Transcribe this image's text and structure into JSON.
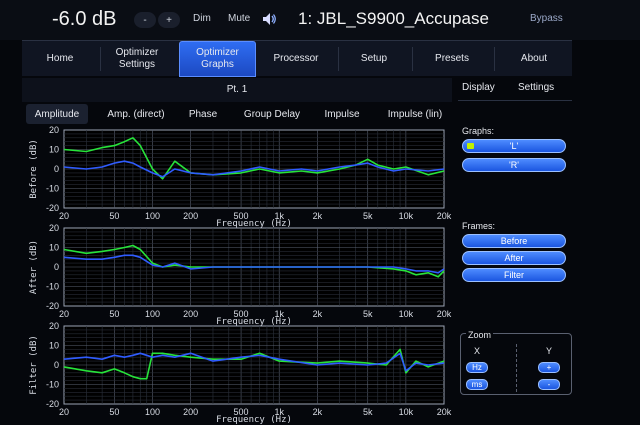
{
  "header": {
    "gain": "-6.0 dB",
    "minus_label": "-",
    "plus_label": "+",
    "dim_label": "Dim",
    "mute_label": "Mute",
    "device_name": "1: JBL_S9900_Accupase",
    "bypass_label": "Bypass"
  },
  "tabs": [
    {
      "label": "Home"
    },
    {
      "label": "Optimizer Settings"
    },
    {
      "label": "Optimizer Graphs"
    },
    {
      "label": "Processor"
    },
    {
      "label": "Setup"
    },
    {
      "label": "Presets"
    },
    {
      "label": "About"
    }
  ],
  "subbar": {
    "title": "Pt. 1",
    "display_tab": "Display",
    "settings_tab": "Settings"
  },
  "view_tabs": [
    {
      "label": "Amplitude"
    },
    {
      "label": "Amp. (direct)"
    },
    {
      "label": "Phase"
    },
    {
      "label": "Group Delay"
    },
    {
      "label": "Impulse"
    },
    {
      "label": "Impulse (lin)"
    }
  ],
  "side": {
    "graphs_label": "Graphs:",
    "graph_buttons": [
      "'L'",
      "'R'"
    ],
    "frames_label": "Frames:",
    "frame_buttons": [
      "Before",
      "After",
      "Filter"
    ],
    "zoom_label": "Zoom",
    "zoom_x": "X",
    "zoom_y": "Y",
    "zoom_hz": "Hz",
    "zoom_ms": "ms",
    "zoom_plus": "+",
    "zoom_minus": "-"
  },
  "colors": {
    "left_trace": "#27e33a",
    "right_trace": "#2f5cff",
    "accent": "#2f6df2",
    "led": "#bff000"
  },
  "chart_data": [
    {
      "type": "line",
      "ylabel": "Before (dB)",
      "xlabel": "Frequency (Hz)",
      "x_scale": "log",
      "xlim": [
        20,
        20000
      ],
      "ylim": [
        -20,
        20
      ],
      "yticks": [
        20,
        10,
        0,
        -10,
        -20
      ],
      "xticks": [
        "20",
        "50",
        "100",
        "200",
        "500",
        "1k",
        "2k",
        "5k",
        "10k",
        "20k"
      ],
      "series": [
        {
          "name": "'L'",
          "x": [
            20,
            30,
            40,
            50,
            60,
            70,
            80,
            100,
            120,
            150,
            200,
            300,
            500,
            700,
            1000,
            1500,
            2000,
            3000,
            4000,
            5000,
            6000,
            8000,
            10000,
            15000,
            20000
          ],
          "y": [
            10,
            9,
            11,
            12,
            14,
            16,
            12,
            0,
            -5,
            4,
            -2,
            -3,
            -2,
            0,
            -2,
            -1,
            -2,
            0,
            2,
            5,
            2,
            0,
            1,
            -3,
            -1
          ]
        },
        {
          "name": "'R'",
          "x": [
            20,
            30,
            40,
            50,
            60,
            70,
            80,
            100,
            120,
            150,
            200,
            300,
            500,
            700,
            1000,
            1500,
            2000,
            3000,
            4000,
            5000,
            6000,
            8000,
            10000,
            15000,
            20000
          ],
          "y": [
            1,
            0,
            1,
            3,
            4,
            3,
            1,
            -2,
            -4,
            0,
            -2,
            -3,
            -1,
            1,
            -1,
            0,
            -1,
            1,
            2,
            3,
            1,
            -1,
            0,
            -1,
            0
          ]
        }
      ]
    },
    {
      "type": "line",
      "ylabel": "After (dB)",
      "xlabel": "Frequency (Hz)",
      "x_scale": "log",
      "xlim": [
        20,
        20000
      ],
      "ylim": [
        -20,
        20
      ],
      "yticks": [
        20,
        10,
        0,
        -10,
        -20
      ],
      "xticks": [
        "20",
        "50",
        "100",
        "200",
        "500",
        "1k",
        "2k",
        "5k",
        "10k",
        "20k"
      ],
      "series": [
        {
          "name": "'L'",
          "x": [
            20,
            30,
            40,
            50,
            60,
            70,
            80,
            100,
            120,
            150,
            200,
            300,
            500,
            700,
            1000,
            1500,
            2000,
            3000,
            5000,
            8000,
            10000,
            12000,
            15000,
            18000,
            20000
          ],
          "y": [
            9,
            7,
            8,
            9,
            10,
            11,
            9,
            2,
            0,
            1,
            0,
            0,
            0,
            0,
            0,
            0,
            0,
            0,
            0,
            -1,
            -2,
            -4,
            -3,
            -5,
            -2
          ]
        },
        {
          "name": "'R'",
          "x": [
            20,
            30,
            40,
            50,
            60,
            70,
            80,
            100,
            120,
            150,
            200,
            300,
            500,
            700,
            1000,
            1500,
            2000,
            3000,
            5000,
            8000,
            10000,
            12000,
            15000,
            18000,
            20000
          ],
          "y": [
            5,
            4,
            4,
            5,
            6,
            6,
            5,
            1,
            0,
            2,
            -1,
            0,
            0,
            0,
            0,
            0,
            0,
            0,
            0,
            0,
            -1,
            -2,
            -2,
            -3,
            -1
          ]
        }
      ]
    },
    {
      "type": "line",
      "ylabel": "Filter (dB)",
      "xlabel": "Frequency (Hz)",
      "x_scale": "log",
      "xlim": [
        20,
        20000
      ],
      "ylim": [
        -20,
        20
      ],
      "yticks": [
        20,
        10,
        0,
        -10,
        -20
      ],
      "xticks": [
        "20",
        "50",
        "100",
        "200",
        "500",
        "1k",
        "2k",
        "5k",
        "10k",
        "20k"
      ],
      "series": [
        {
          "name": "'L'",
          "x": [
            20,
            30,
            40,
            50,
            60,
            70,
            80,
            90,
            100,
            120,
            150,
            200,
            300,
            500,
            700,
            1000,
            2000,
            3000,
            5000,
            7000,
            9000,
            10000,
            12000,
            15000,
            20000
          ],
          "y": [
            -1,
            -3,
            -4,
            -2,
            -4,
            -6,
            -7,
            -7,
            6,
            6,
            5,
            4,
            3,
            3,
            6,
            2,
            1,
            2,
            1,
            0,
            8,
            -4,
            2,
            -1,
            2
          ]
        },
        {
          "name": "'R'",
          "x": [
            20,
            30,
            40,
            50,
            60,
            70,
            80,
            90,
            100,
            120,
            150,
            200,
            300,
            500,
            700,
            1000,
            2000,
            3000,
            5000,
            7000,
            9000,
            10000,
            12000,
            15000,
            20000
          ],
          "y": [
            3,
            4,
            3,
            5,
            4,
            5,
            6,
            5,
            4,
            5,
            4,
            6,
            2,
            4,
            5,
            3,
            0,
            1,
            0,
            1,
            6,
            -3,
            1,
            0,
            1
          ]
        }
      ]
    }
  ]
}
